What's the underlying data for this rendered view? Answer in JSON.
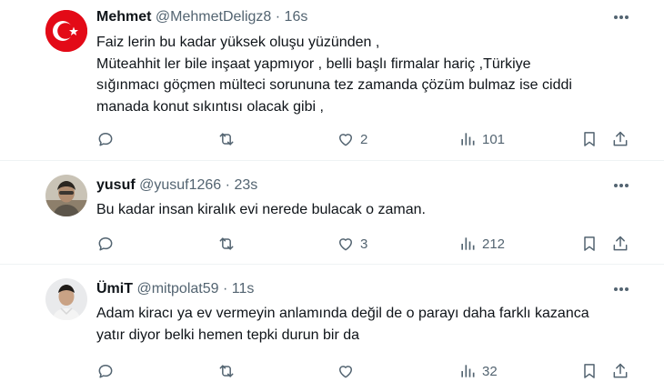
{
  "tweets": [
    {
      "name": "Mehmet",
      "handle": "@MehmetDeligz8",
      "separator": "·",
      "time": "16s",
      "text": "Faiz lerin bu kadar yüksek oluşu yüzünden ,\nMüteahhit ler bile inşaat yapmıyor , belli başlı firmalar hariç ,Türkiye\nsığınmacı göçmen mülteci sorununa tez zamanda çözüm bulmaz ise ciddi\nmanada konut sıkıntısı olacak gibi ,",
      "likes": "2",
      "views": "101"
    },
    {
      "name": "yusuf",
      "handle": "@yusuf1266",
      "separator": "·",
      "time": "23s",
      "text": "Bu kadar insan kiralık evi nerede bulacak o zaman.",
      "likes": "3",
      "views": "212"
    },
    {
      "name": "ÜmiT",
      "handle": "@mitpolat59",
      "separator": "·",
      "time": "11s",
      "text": "Adam kiracı ya ev vermeyin anlamında değil de o parayı daha farklı kazanca\nyatır diyor belki hemen tepki durun bir da",
      "likes": "",
      "views": "32"
    }
  ],
  "icons": {
    "more": "more-horizontal-icon",
    "reply": "reply-icon",
    "retweet": "retweet-icon",
    "like": "heart-icon",
    "views": "views-icon",
    "bookmark": "bookmark-icon",
    "share": "share-icon"
  },
  "colors": {
    "text": "#0f1419",
    "secondary": "#536471",
    "divider": "#eff3f4",
    "turkey_red": "#e30a17"
  }
}
